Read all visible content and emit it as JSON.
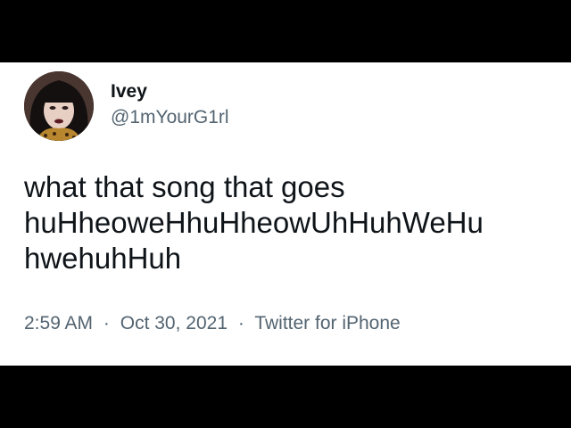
{
  "colors": {
    "background": "#000000",
    "card": "#ffffff",
    "primary_text": "#0f1419",
    "secondary_text": "#536471"
  },
  "author": {
    "display_name": "Ivey",
    "handle": "@1mYourG1rl",
    "avatar_icon": "profile-photo"
  },
  "tweet": {
    "text": "what that song that goes\nhuHheoweHhuHheowUhHuhWeHu\nhwehuhHuh"
  },
  "meta": {
    "time": "2:59 AM",
    "separator": "·",
    "date": "Oct 30, 2021",
    "source": "Twitter for iPhone"
  }
}
